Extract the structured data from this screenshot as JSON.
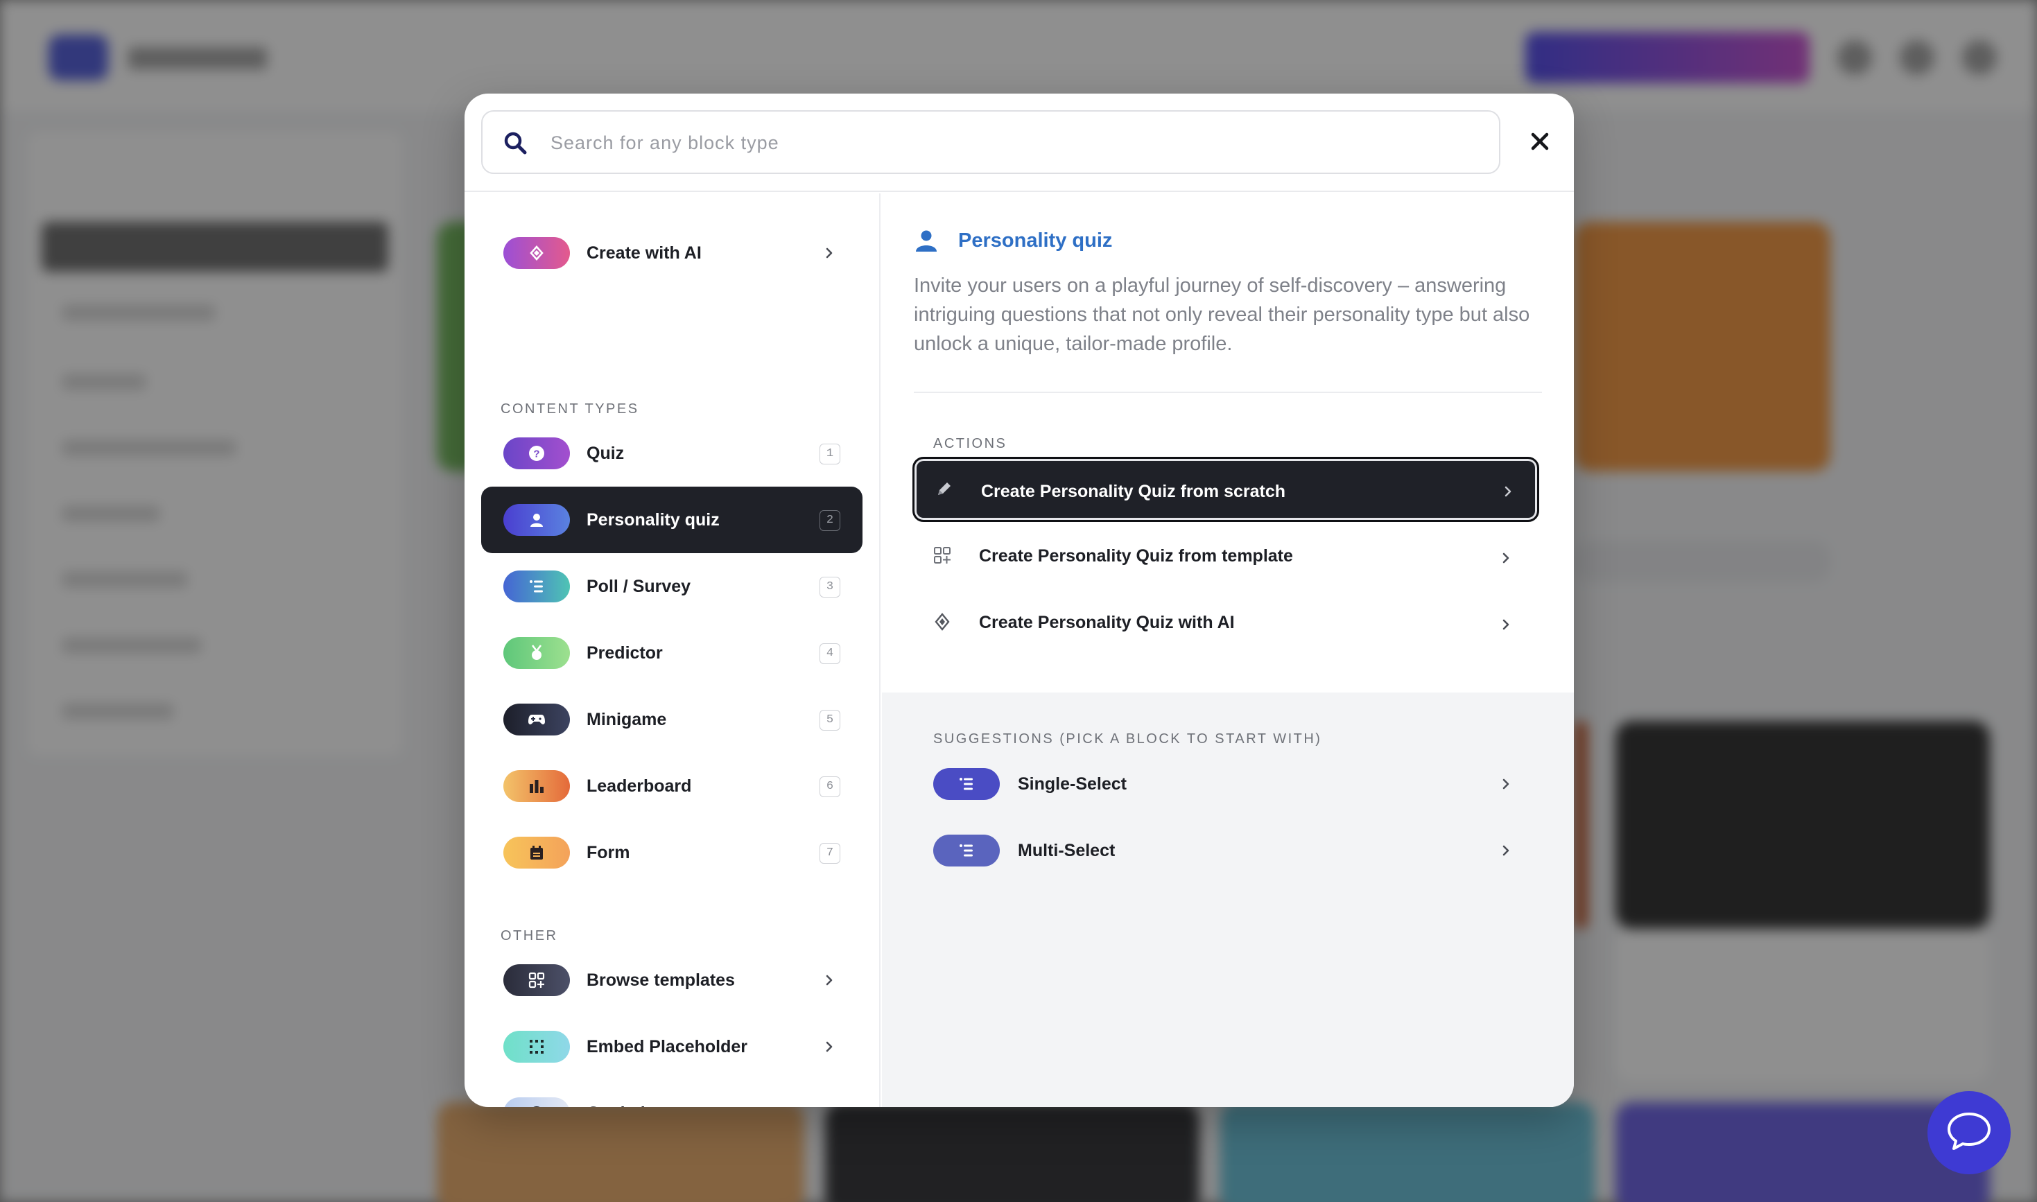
{
  "search": {
    "placeholder": "Search for any block type"
  },
  "create_ai": {
    "label": "Create with AI"
  },
  "content_types": {
    "heading": "CONTENT TYPES",
    "items": [
      {
        "label": "Quiz",
        "shortcut": "1"
      },
      {
        "label": "Personality quiz",
        "shortcut": "2"
      },
      {
        "label": "Poll / Survey",
        "shortcut": "3"
      },
      {
        "label": "Predictor",
        "shortcut": "4"
      },
      {
        "label": "Minigame",
        "shortcut": "5"
      },
      {
        "label": "Leaderboard",
        "shortcut": "6"
      },
      {
        "label": "Form",
        "shortcut": "7"
      }
    ]
  },
  "other": {
    "heading": "OTHER",
    "items": [
      {
        "label": "Browse templates"
      },
      {
        "label": "Embed Placeholder"
      },
      {
        "label": "Get help"
      }
    ]
  },
  "detail": {
    "title": "Personality quiz",
    "description": "Invite your users on a playful journey of self-discovery – answering intriguing questions that not only reveal their personality type but also unlock a unique, tailor-made profile.",
    "actions_heading": "ACTIONS",
    "actions": [
      {
        "label": "Create Personality Quiz from scratch"
      },
      {
        "label": "Create Personality Quiz from template"
      },
      {
        "label": "Create Personality Quiz with AI"
      }
    ],
    "suggestions_heading": "SUGGESTIONS (PICK A BLOCK TO START WITH)",
    "suggestions": [
      {
        "label": "Single-Select"
      },
      {
        "label": "Multi-Select"
      }
    ]
  },
  "colors": {
    "active_row": "#1f2128",
    "detail_title": "#2e6fc5",
    "chat_button": "#3e3ad3"
  }
}
